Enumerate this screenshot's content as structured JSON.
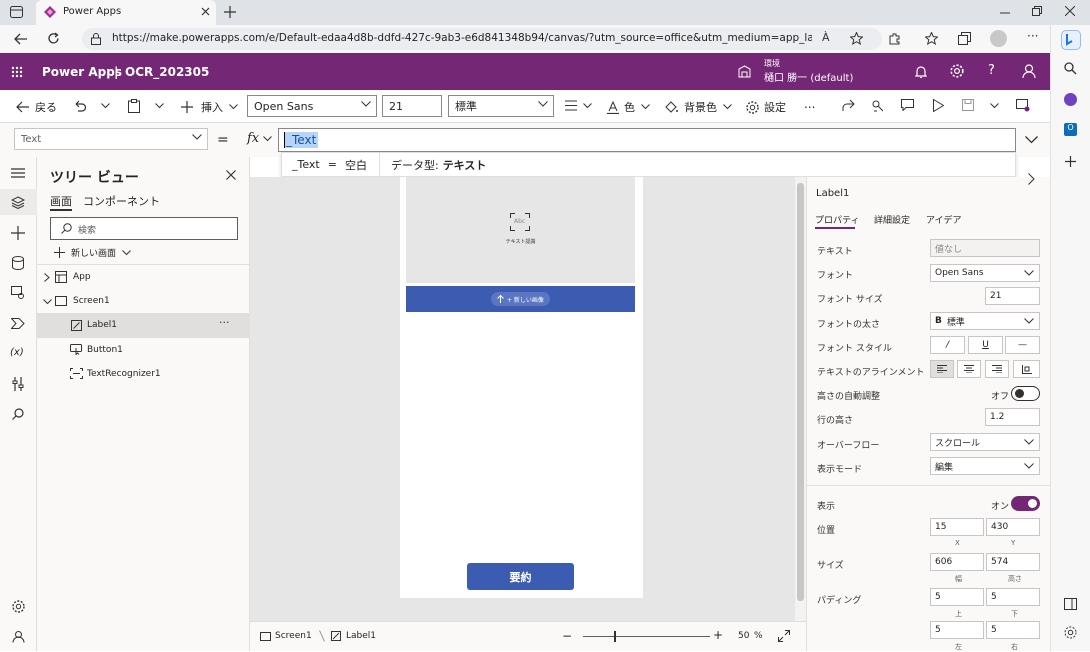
{
  "browser": {
    "tab_title": "Power Apps",
    "url": "https://make.powerapps.com/e/Default-edaa4d8b-ddfd-427c-9ab3-e6d841348b94/canvas/?utm_source=office&utm_medium=app_launcher&utm_...",
    "reader_icon": "À"
  },
  "header": {
    "app_name": "Power Apps",
    "separator": "|",
    "project": "OCR_202305",
    "env_label": "環境",
    "env_name": "樋口 勝一 (default)"
  },
  "cmdbar": {
    "back": "戻る",
    "insert": "挿入",
    "font": "Open Sans",
    "font_size": "21",
    "weight": "標準",
    "color": "色",
    "bgcolor": "背景色",
    "settings": "設定",
    "more": "..."
  },
  "formula": {
    "property": "Text",
    "equals": "=",
    "fx": "fx",
    "expression": "_Text",
    "hint_name": "_Text",
    "hint_eq": "=",
    "hint_value": "空白",
    "hint_type_label": "データ型:",
    "hint_type_value": "テキスト"
  },
  "tree": {
    "title": "ツリー ビュー",
    "tab_screens": "画面",
    "tab_components": "コンポーネント",
    "search_placeholder": "検索",
    "new_screen": "新しい画面",
    "items": [
      {
        "label": "App"
      },
      {
        "label": "Screen1"
      },
      {
        "label": "Label1"
      },
      {
        "label": "Button1"
      },
      {
        "label": "TextRecognizer1"
      }
    ],
    "item_more": "···"
  },
  "canvas": {
    "recognizer_caption": "テキスト認識",
    "recognizer_glyph": "Abc",
    "new_image": "+ 新しい画像",
    "summary_button": "要約"
  },
  "status": {
    "crumb1": "Screen1",
    "crumb2": "Label1",
    "zoom": "50",
    "zoom_unit": "%",
    "minus": "−",
    "plus": "+"
  },
  "props": {
    "control_name": "Label1",
    "tabs": [
      "プロパティ",
      "詳細設定",
      "アイデア"
    ],
    "text_label": "テキスト",
    "text_value": "値なし",
    "font_label": "フォント",
    "font_value": "Open Sans",
    "size_label": "フォント サイズ",
    "size_value": "21",
    "weight_label": "フォントの太さ",
    "weight_bold": "B",
    "weight_value": "標準",
    "style_label": "フォント スタイル",
    "style_italic": "/",
    "style_underline": "U",
    "style_strike": "—",
    "align_label": "テキストのアラインメント",
    "autoheight_label": "高さの自動調整",
    "autoheight_value": "オフ",
    "autoheight_on": false,
    "lineheight_label": "行の高さ",
    "lineheight_value": "1.2",
    "overflow_label": "オーバーフロー",
    "overflow_value": "スクロール",
    "mode_label": "表示モード",
    "mode_value": "編集",
    "visible_label": "表示",
    "visible_value": "オン",
    "visible_on": true,
    "pos_label": "位置",
    "pos_x": "15",
    "pos_y": "430",
    "x_label": "X",
    "y_label": "Y",
    "size2_label": "サイズ",
    "width": "606",
    "height": "574",
    "w_label": "幅",
    "h_label": "高さ",
    "pad_label": "パディング",
    "pad_top": "5",
    "pad_bottom": "5",
    "pad_left": "5",
    "pad_right": "5",
    "top_label": "上",
    "bottom_label": "下",
    "left_label": "左",
    "right_label": "右"
  },
  "colors": {
    "header_bg": "#742774",
    "accent": "#3b5cb0",
    "toggle_on": "#742774"
  }
}
